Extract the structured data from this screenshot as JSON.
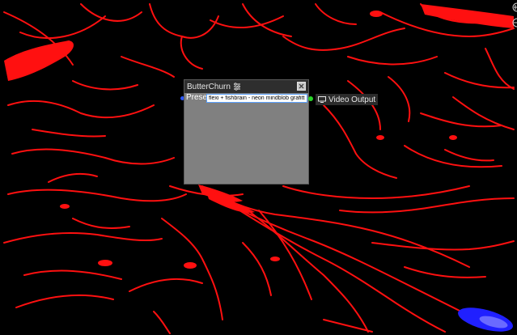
{
  "node": {
    "title": "ButterChurn",
    "preset_label": "Preset",
    "preset_value": "flexi + fishbrain - neon mindblob grafitti"
  },
  "output": {
    "label": "Video Output"
  },
  "icons": {
    "sliders": "sliders-icon",
    "close": "close-icon",
    "monitor": "monitor-icon",
    "zoom_in": "zoom-in-icon",
    "zoom_out": "zoom-out-icon"
  },
  "colors": {
    "background": "#000000",
    "strokes": "#ff0000",
    "blob": "#1a1aff",
    "input_port": "#2a56ff",
    "output_port": "#27d327",
    "node_body": "#808080",
    "node_header": "#2e2e2e"
  }
}
